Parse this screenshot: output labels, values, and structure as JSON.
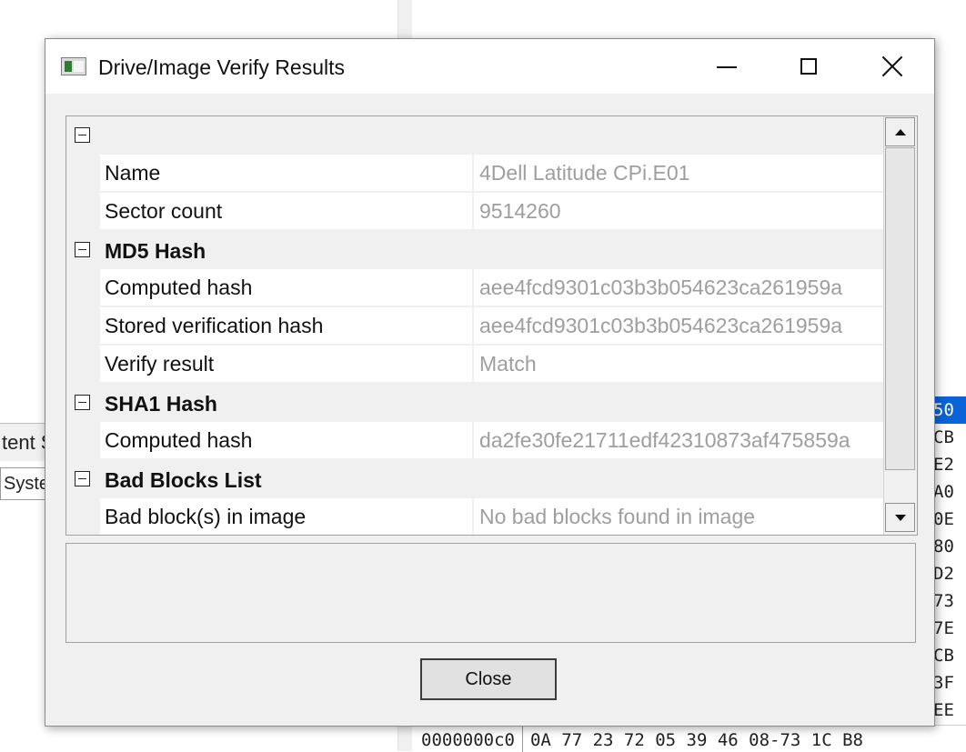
{
  "background": {
    "left_tab_1": "tent S",
    "left_tab_2": "Syste",
    "hex_right_column": [
      "50",
      "CB",
      "E2",
      "A0",
      "0E",
      "80",
      "D2",
      "73",
      "7E",
      "CB",
      "3F",
      "EE"
    ],
    "hex_bottom_row": {
      "offset": "0000000c0",
      "bytes": "0A 77 23 72 05 39 46 08-73 1C B8"
    }
  },
  "dialog": {
    "title": "Drive/Image Verify Results",
    "categories": [
      {
        "label": "",
        "rows": [
          {
            "label": "Name",
            "value": "4Dell Latitude CPi.E01"
          },
          {
            "label": "Sector count",
            "value": "9514260"
          }
        ]
      },
      {
        "label": "MD5 Hash",
        "rows": [
          {
            "label": "Computed hash",
            "value": "aee4fcd9301c03b3b054623ca261959a"
          },
          {
            "label": "Stored verification hash",
            "value": "aee4fcd9301c03b3b054623ca261959a"
          },
          {
            "label": "Verify result",
            "value": "Match"
          }
        ]
      },
      {
        "label": "SHA1 Hash",
        "rows": [
          {
            "label": "Computed hash",
            "value": "da2fe30fe21711edf42310873af475859a"
          }
        ]
      },
      {
        "label": "Bad Blocks List",
        "rows": [
          {
            "label": "Bad block(s) in image",
            "value": "No bad blocks found in image"
          }
        ]
      }
    ],
    "close_label": "Close"
  }
}
